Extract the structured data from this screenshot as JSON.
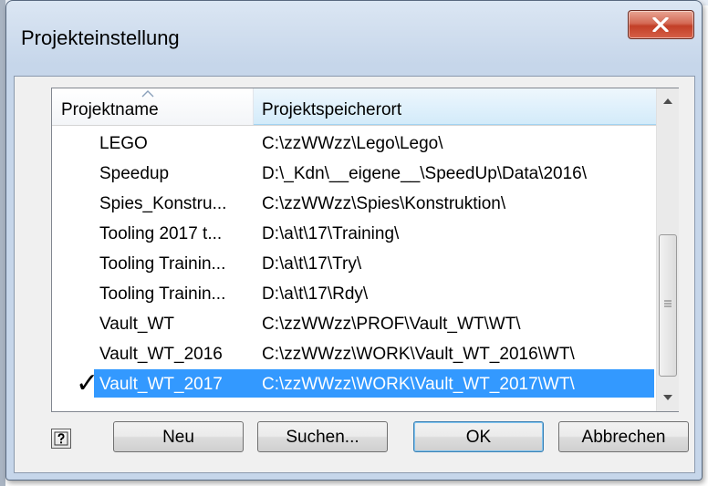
{
  "window": {
    "title": "Projekteinstellung"
  },
  "list": {
    "columns": {
      "name": "Projektname",
      "location": "Projektspeicherort"
    },
    "rows": [
      {
        "name": "LEGO",
        "location": "C:\\zzWWzz\\Lego\\Lego\\",
        "active": false,
        "selected": false
      },
      {
        "name": "Speedup",
        "location": "D:\\_Kdn\\__eigene__\\SpeedUp\\Data\\2016\\",
        "active": false,
        "selected": false
      },
      {
        "name": "Spies_Konstru...",
        "location": "C:\\zzWWzz\\Spies\\Konstruktion\\",
        "active": false,
        "selected": false
      },
      {
        "name": "Tooling 2017 t...",
        "location": "D:\\a\\t\\17\\Training\\",
        "active": false,
        "selected": false
      },
      {
        "name": "Tooling Trainin...",
        "location": "D:\\a\\t\\17\\Try\\",
        "active": false,
        "selected": false
      },
      {
        "name": "Tooling Trainin...",
        "location": "D:\\a\\t\\17\\Rdy\\",
        "active": false,
        "selected": false
      },
      {
        "name": "Vault_WT",
        "location": "C:\\zzWWzz\\PROF\\Vault_WT\\WT\\",
        "active": false,
        "selected": false
      },
      {
        "name": "Vault_WT_2016",
        "location": "C:\\zzWWzz\\WORK\\Vault_WT_2016\\WT\\",
        "active": false,
        "selected": false
      },
      {
        "name": "Vault_WT_2017",
        "location": "C:\\zzWWzz\\WORK\\Vault_WT_2017\\WT\\",
        "active": true,
        "selected": true
      }
    ],
    "active_mark": "✓"
  },
  "buttons": {
    "new": "Neu",
    "search": "Suchen...",
    "ok": "OK",
    "cancel": "Abbrechen"
  },
  "colors": {
    "selection": "#3399ff",
    "close_button": "#c94a33"
  },
  "icons": {
    "help": "help-question-icon",
    "close": "close-x-icon",
    "sort": "sort-ascending-icon"
  }
}
